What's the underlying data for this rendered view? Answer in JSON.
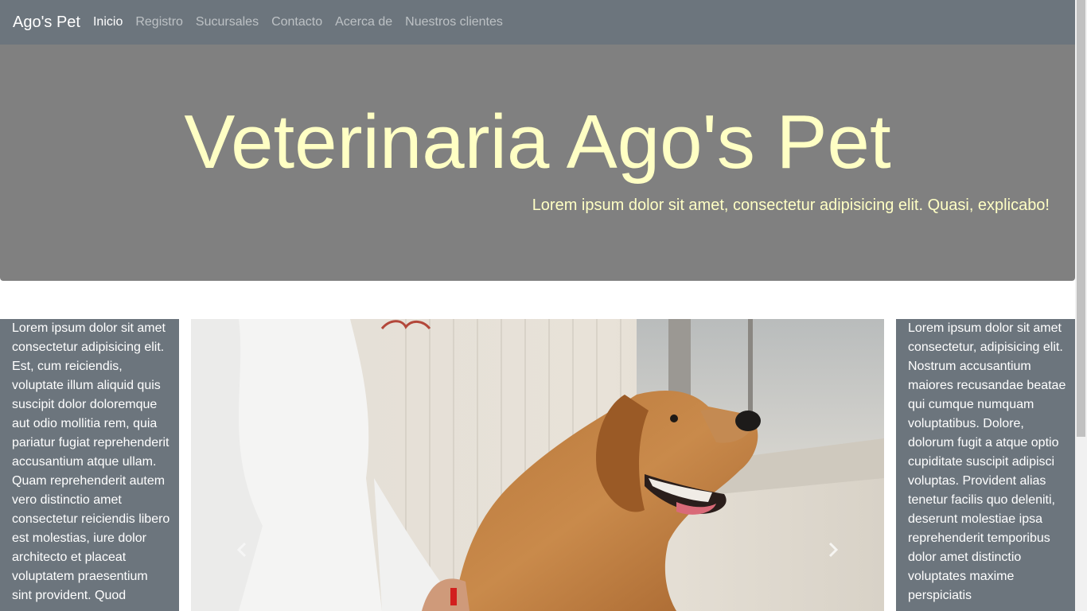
{
  "navbar": {
    "brand": "Ago's Pet",
    "items": [
      {
        "label": "Inicio",
        "active": true
      },
      {
        "label": "Registro",
        "active": false
      },
      {
        "label": "Sucursales",
        "active": false
      },
      {
        "label": "Contacto",
        "active": false
      },
      {
        "label": "Acerca de",
        "active": false
      },
      {
        "label": "Nuestros clientes",
        "active": false
      }
    ]
  },
  "hero": {
    "title": "Veterinaria Ago's Pet",
    "subtitle": "Lorem ipsum dolor sit amet, consectetur adipisicing elit. Quasi, explicabo!"
  },
  "left_panel": {
    "text": "Lorem ipsum dolor sit amet consectetur adipisicing elit. Est, cum reiciendis, voluptate illum aliquid quis suscipit dolor doloremque aut odio mollitia rem, quia pariatur fugiat reprehenderit accusantium atque ullam. Quam reprehenderit autem vero distinctio amet consectetur reiciendis libero est molestias, iure dolor architecto et placeat voluptatem praesentium sint provident. Quod"
  },
  "right_panel": {
    "text": "Lorem ipsum dolor sit amet consectetur, adipisicing elit. Nostrum accusantium maiores recusandae beatae qui cumque numquam voluptatibus. Dolore, dolorum fugit a atque optio cupiditate suscipit adipisci voluptas. Provident alias tenetur facilis quo deleniti, deserunt molestiae ipsa reprehenderit temporibus dolor amet distinctio voluptates maxime perspiciatis"
  },
  "carousel": {
    "image": "dog-at-veterinary",
    "prev_icon": "chevron-left-icon",
    "next_icon": "chevron-right-icon"
  },
  "colors": {
    "navbar_bg": "#6c757d",
    "hero_bg": "#808080",
    "hero_text": "#ffffc4"
  }
}
